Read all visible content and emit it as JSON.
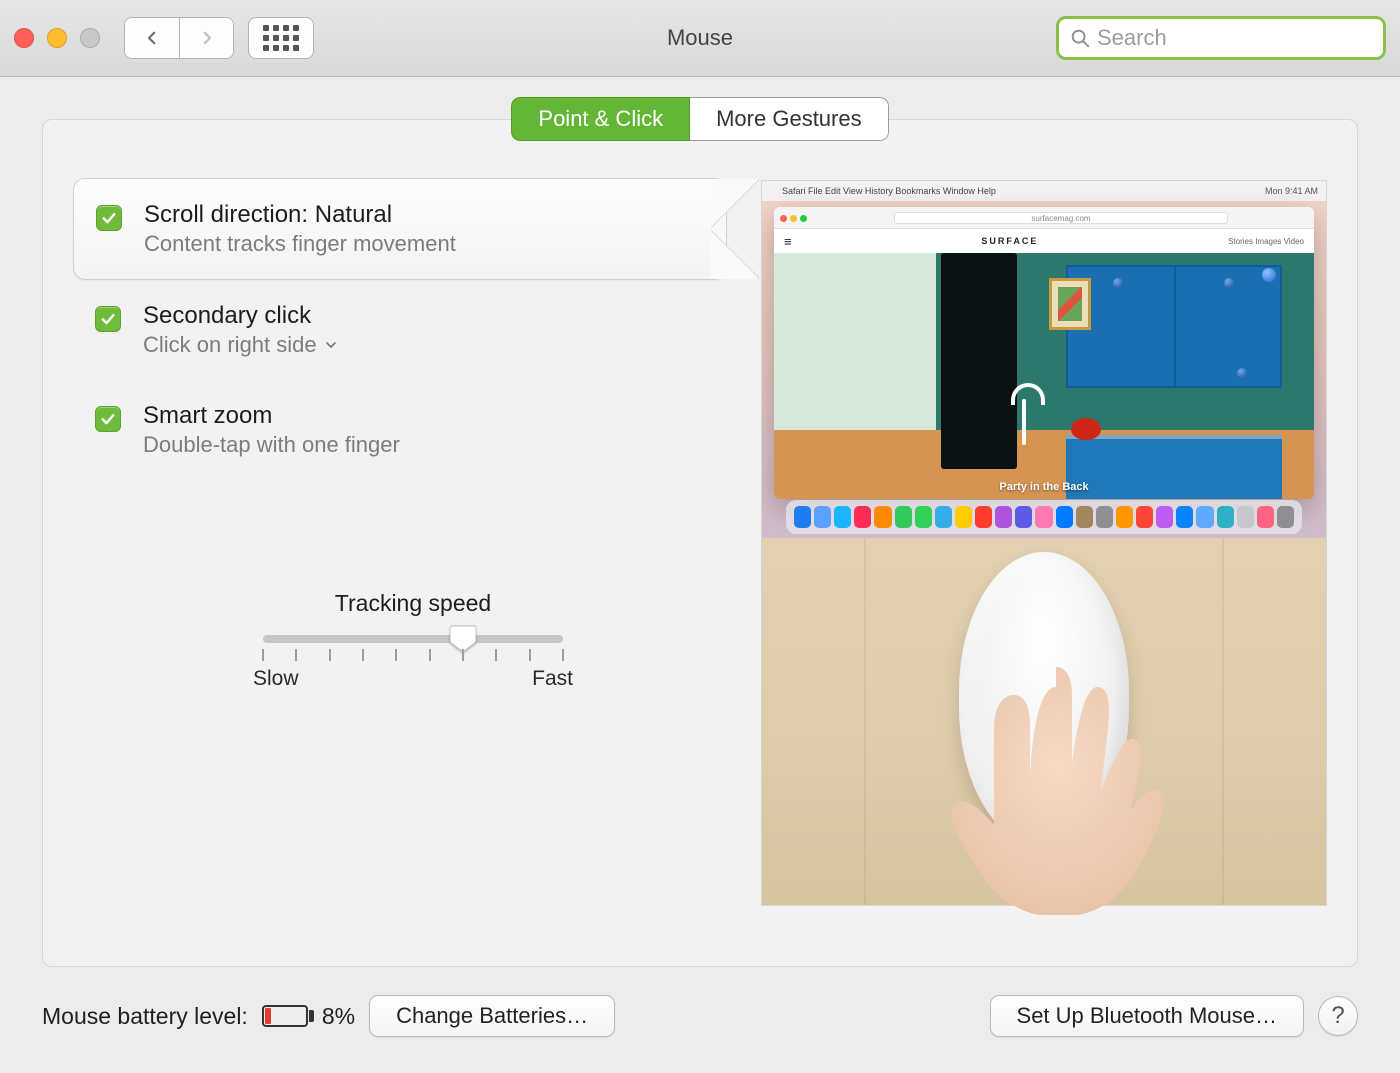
{
  "window": {
    "title": "Mouse"
  },
  "search": {
    "placeholder": "Search"
  },
  "tabs": {
    "point_click": "Point & Click",
    "more_gestures": "More Gestures"
  },
  "options": {
    "scroll": {
      "title": "Scroll direction: Natural",
      "subtitle": "Content tracks finger movement",
      "checked": true,
      "selected": true
    },
    "secondary": {
      "title": "Secondary click",
      "subtitle": "Click on right side",
      "checked": true
    },
    "smartzoom": {
      "title": "Smart zoom",
      "subtitle": "Double-tap with one finger",
      "checked": true
    }
  },
  "tracking": {
    "label": "Tracking speed",
    "slow": "Slow",
    "fast": "Fast",
    "value_index": 6,
    "tick_count": 10
  },
  "preview": {
    "menubar_left": "Safari   File   Edit   View   History   Bookmarks   Window   Help",
    "menubar_right": "Mon 9:41 AM",
    "site_brand": "SURFACE",
    "site_nav": "Stories  Images  Video",
    "url": "surfacemag.com",
    "hamburger": "≡",
    "caption": "Party in the Back"
  },
  "bottom": {
    "battery_label": "Mouse battery level:",
    "battery_percent": "8%",
    "change_batteries": "Change Batteries…",
    "setup_bluetooth": "Set Up Bluetooth Mouse…",
    "help": "?"
  },
  "colors": {
    "accent": "#64b736",
    "search_ring": "#8cbf4c"
  }
}
